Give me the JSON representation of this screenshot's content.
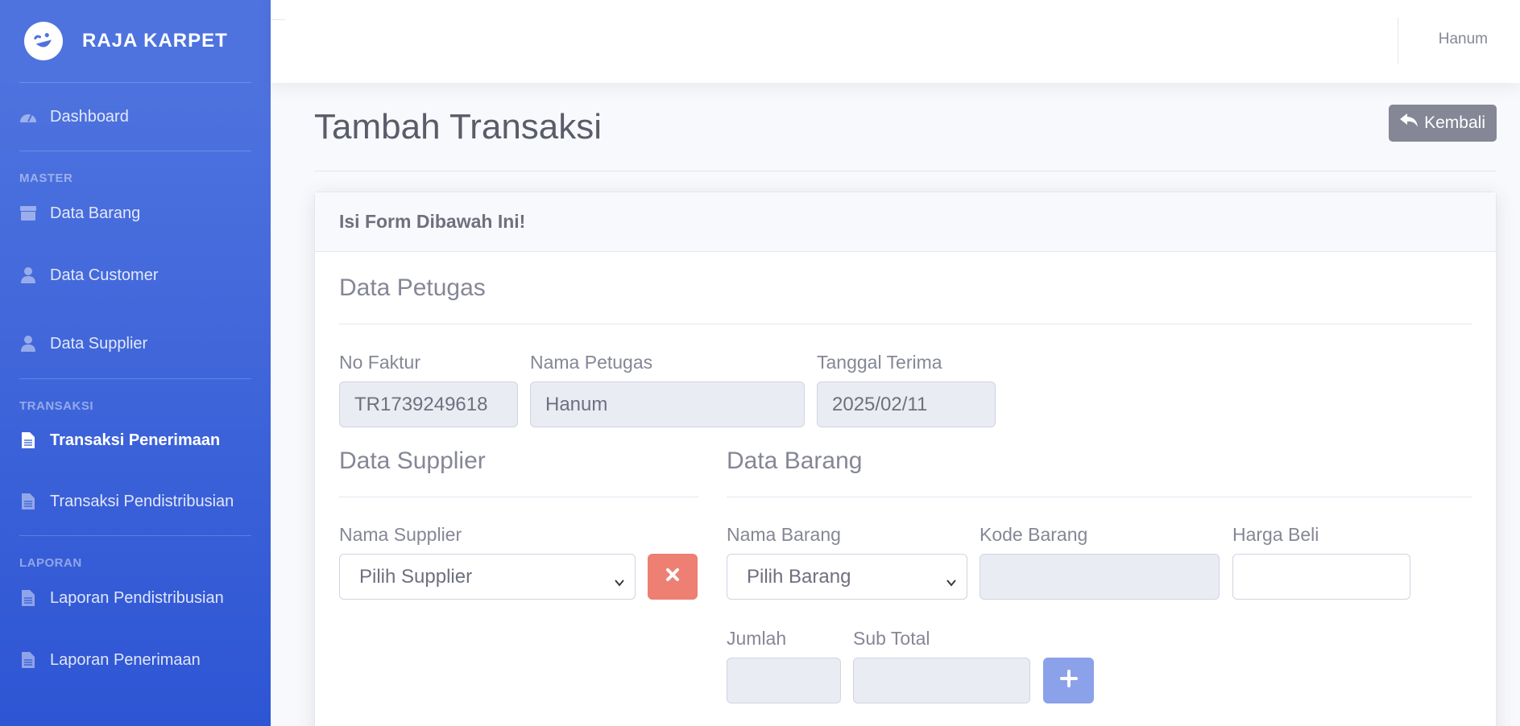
{
  "brand": {
    "name": "RAJA KARPET",
    "icon": "laugh-wink-icon"
  },
  "sidebar": {
    "dashboard": "Dashboard",
    "heading_master": "MASTER",
    "data_barang": "Data Barang",
    "data_customer": "Data Customer",
    "data_supplier": "Data Supplier",
    "heading_transaksi": "TRANSAKSI",
    "transaksi_penerimaan": "Transaksi Penerimaan",
    "transaksi_pendistribusian": "Transaksi Pendistribusian",
    "heading_laporan": "LAPORAN",
    "laporan_pendistribusian": "Laporan Pendistribusian",
    "laporan_penerimaan": "Laporan Penerimaan"
  },
  "topbar": {
    "user": "Hanum"
  },
  "page": {
    "title": "Tambah Transaksi",
    "back_label": "Kembali"
  },
  "card": {
    "header": "Isi Form Dibawah Ini!"
  },
  "petugas": {
    "section": "Data Petugas",
    "no_faktur_label": "No Faktur",
    "no_faktur_value": "TR1739249618",
    "nama_petugas_label": "Nama Petugas",
    "nama_petugas_value": "Hanum",
    "tanggal_label": "Tanggal Terima",
    "tanggal_value": "2025/02/11"
  },
  "supplier": {
    "section": "Data Supplier",
    "nama_label": "Nama Supplier",
    "nama_selected": "Pilih Supplier"
  },
  "barang": {
    "section": "Data Barang",
    "nama_label": "Nama Barang",
    "nama_selected": "Pilih Barang",
    "kode_label": "Kode Barang",
    "kode_value": "",
    "harga_label": "Harga Beli",
    "harga_value": "",
    "jumlah_label": "Jumlah",
    "jumlah_value": "",
    "subtotal_label": "Sub Total",
    "subtotal_value": ""
  },
  "colors": {
    "sidebar_primary": "#4e73df",
    "danger": "#ed7f73",
    "add_button": "#8ba1ea",
    "secondary": "#858796"
  }
}
